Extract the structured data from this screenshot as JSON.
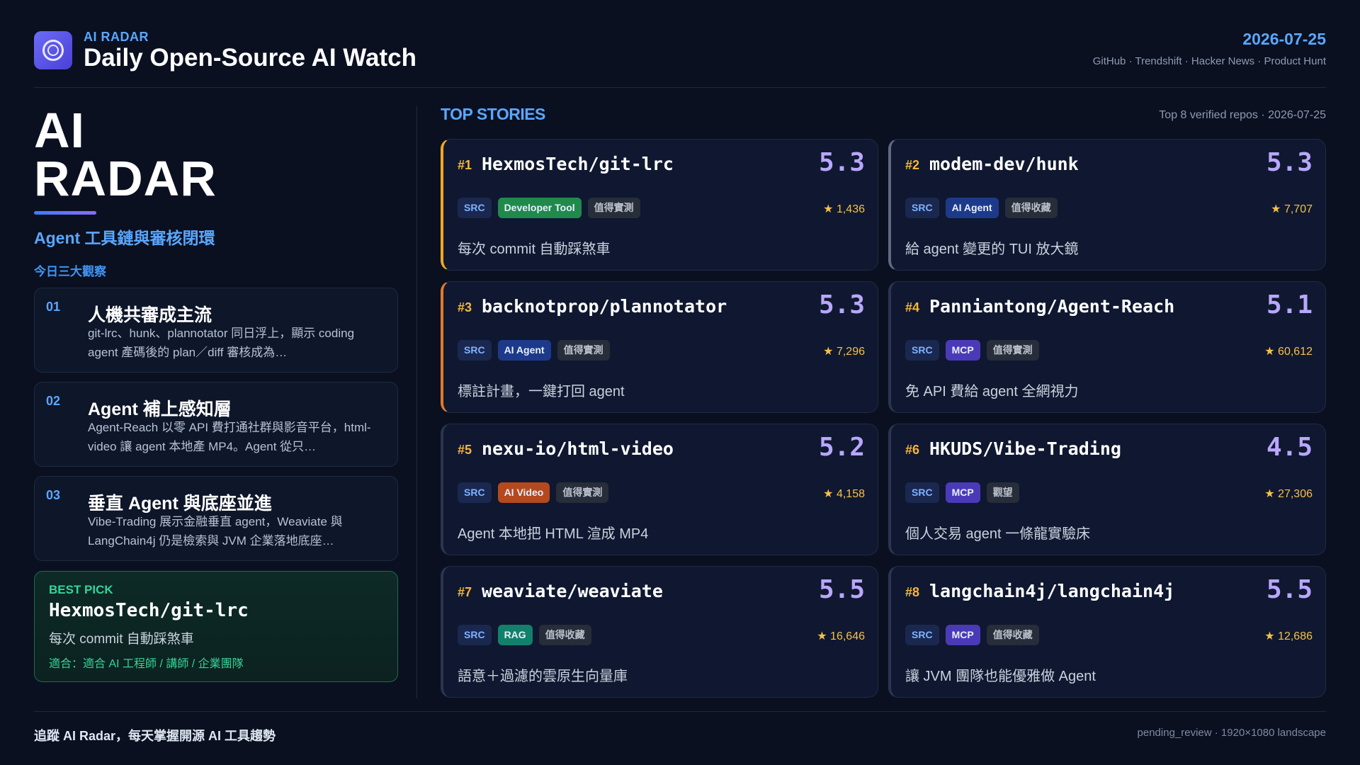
{
  "header": {
    "kicker": "AI RADAR",
    "title": "Daily Open-Source AI Watch",
    "date": "2026-07-25",
    "sources": "GitHub · Trendshift · Hacker News · Product Hunt"
  },
  "sidebar": {
    "big_title_line1": "AI",
    "big_title_line2": "RADAR",
    "subtitle": "Agent 工具鏈與審核閉環",
    "insight_label": "今日三大觀察",
    "insights": [
      {
        "num": "01",
        "title": "人機共審成主流",
        "body": "git-lrc、hunk、plannotator 同日浮上，顯示 coding agent 產碼後的 plan／diff 審核成為…"
      },
      {
        "num": "02",
        "title": "Agent 補上感知層",
        "body": "Agent-Reach 以零 API 費打通社群與影音平台，html-video 讓 agent 本地產 MP4。Agent 從只…"
      },
      {
        "num": "03",
        "title": "垂直 Agent 與底座並進",
        "body": "Vibe-Trading 展示金融垂直 agent，Weaviate 與 LangChain4j 仍是檢索與 JVM 企業落地底座…"
      }
    ],
    "best_pick": {
      "label": "BEST PICK",
      "repo": "HexmosTech/git-lrc",
      "desc": "每次 commit 自動踩煞車",
      "fit": "適合：適合 AI 工程師 / 講師 / 企業團隊"
    }
  },
  "main": {
    "section_title": "TOP STORIES",
    "section_meta": "Top 8 verified repos · 2026-07-25",
    "cards": [
      {
        "rank": "#1",
        "repo": "HexmosTech/git-lrc",
        "score": "5.3",
        "src": "SRC",
        "category": "Developer Tool",
        "verdict": "值得實測",
        "stars": "★ 1,436",
        "desc": "每次 commit 自動踩煞車"
      },
      {
        "rank": "#2",
        "repo": "modem-dev/hunk",
        "score": "5.3",
        "src": "SRC",
        "category": "AI Agent",
        "verdict": "值得收藏",
        "stars": "★ 7,707",
        "desc": "給 agent 變更的 TUI 放大鏡"
      },
      {
        "rank": "#3",
        "repo": "backnotprop/plannotator",
        "score": "5.3",
        "src": "SRC",
        "category": "AI Agent",
        "verdict": "值得實測",
        "stars": "★ 7,296",
        "desc": "標註計畫，一鍵打回 agent"
      },
      {
        "rank": "#4",
        "repo": "Panniantong/Agent-Reach",
        "score": "5.1",
        "src": "SRC",
        "category": "MCP",
        "verdict": "值得實測",
        "stars": "★ 60,612",
        "desc": "免 API 費給 agent 全網視力"
      },
      {
        "rank": "#5",
        "repo": "nexu-io/html-video",
        "score": "5.2",
        "src": "SRC",
        "category": "AI Video",
        "verdict": "值得實測",
        "stars": "★ 4,158",
        "desc": "Agent 本地把 HTML 渲成 MP4"
      },
      {
        "rank": "#6",
        "repo": "HKUDS/Vibe-Trading",
        "score": "4.5",
        "src": "SRC",
        "category": "MCP",
        "verdict": "觀望",
        "stars": "★ 27,306",
        "desc": "個人交易 agent 一條龍實驗床"
      },
      {
        "rank": "#7",
        "repo": "weaviate/weaviate",
        "score": "5.5",
        "src": "SRC",
        "category": "RAG",
        "verdict": "值得收藏",
        "stars": "★ 16,646",
        "desc": "語意＋過濾的雲原生向量庫"
      },
      {
        "rank": "#8",
        "repo": "langchain4j/langchain4j",
        "score": "5.5",
        "src": "SRC",
        "category": "MCP",
        "verdict": "值得收藏",
        "stars": "★ 12,686",
        "desc": "讓 JVM 團隊也能優雅做 Agent"
      }
    ]
  },
  "footer": {
    "tagline": "追蹤 AI Radar，每天掌握開源 AI 工具趨勢",
    "status": "pending_review · 1920×1080 landscape"
  },
  "colors": {
    "background": "#0a1020",
    "accent_blue": "#5aa7ff",
    "score_purple": "#b9a7ff",
    "rank_gold": "#f5b63a",
    "best_green": "#34d399",
    "category_colors": {
      "Developer Tool": "#1f8a4c",
      "AI Agent": "#1d3a8a",
      "MCP": "#4b3ab8",
      "AI Video": "#b4491e",
      "RAG": "#12806a"
    }
  },
  "icons": {
    "logo": "radar-ring-icon",
    "star": "star-icon"
  }
}
